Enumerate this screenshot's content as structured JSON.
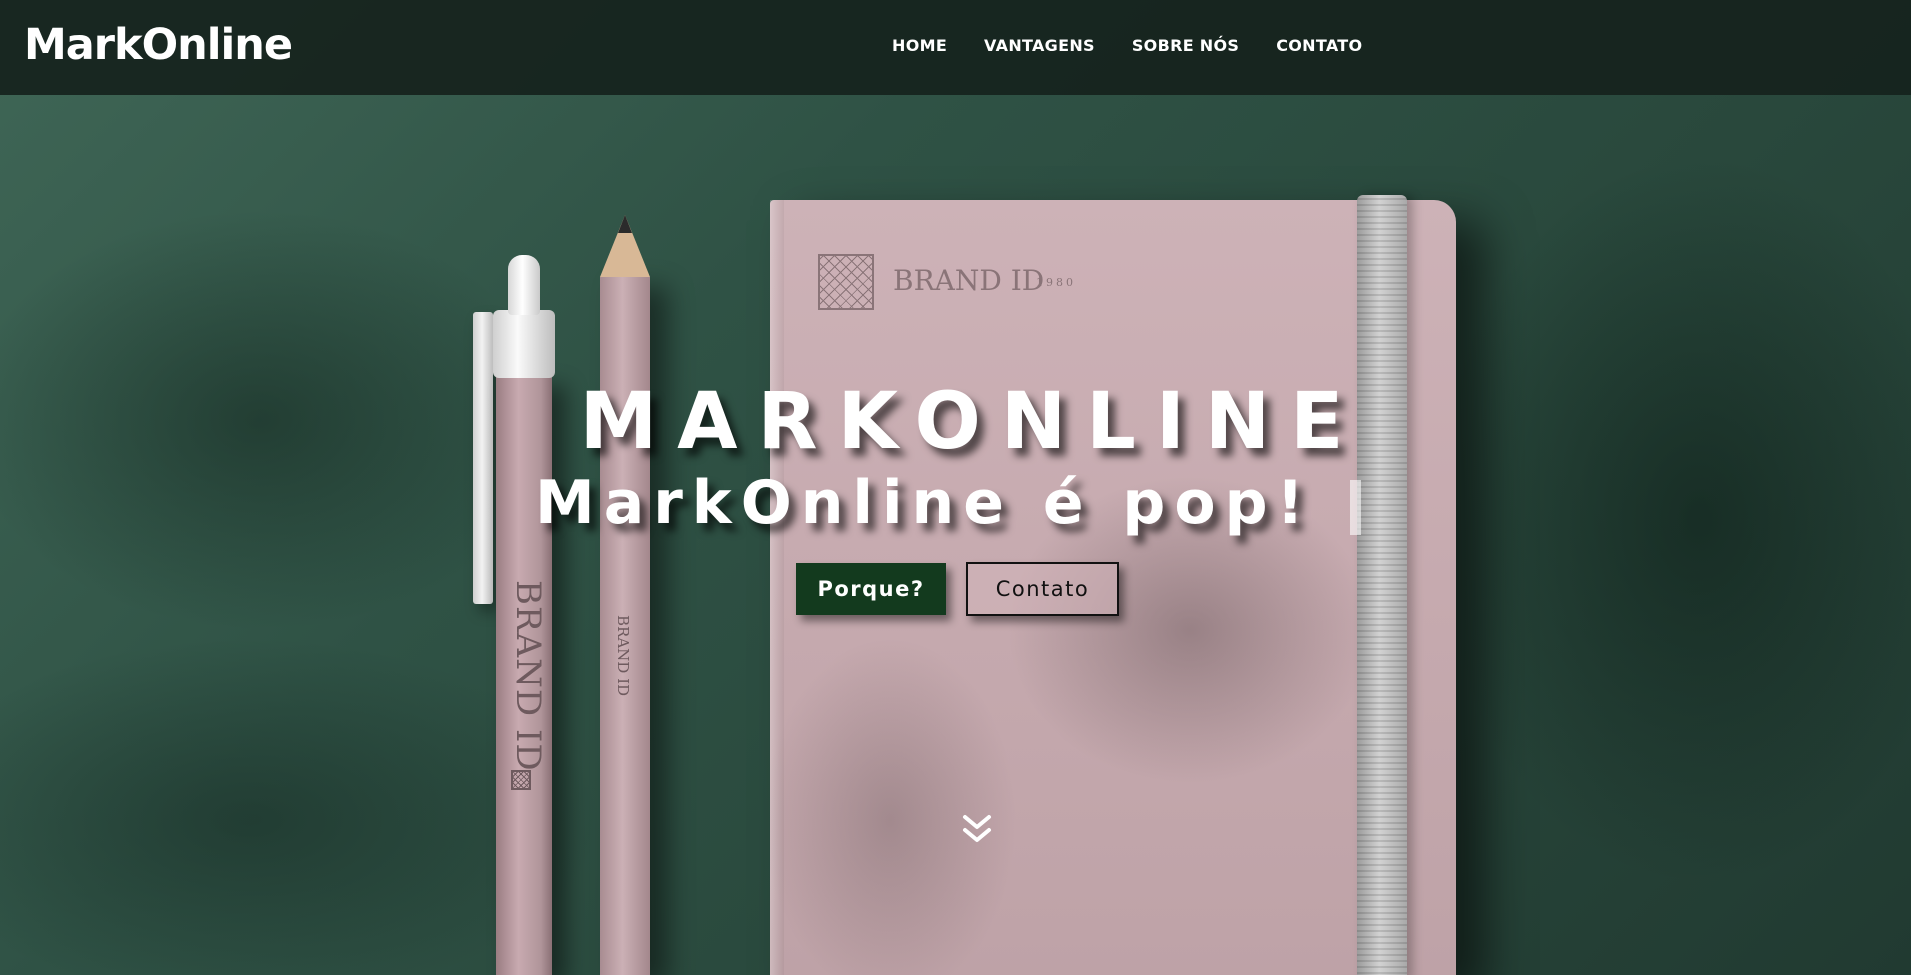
{
  "navbar": {
    "brand": "MarkOnline",
    "links": [
      {
        "label": "HOME"
      },
      {
        "label": "VANTAGENS"
      },
      {
        "label": "SOBRE NÓS"
      },
      {
        "label": "CONTATO"
      }
    ]
  },
  "hero": {
    "title": "MARKONLINE",
    "subtitle": "MarkOnline é pop!",
    "buttons": {
      "primary": "Porque?",
      "secondary": "Contato"
    },
    "scroll_icon": "double-chevron-down-icon"
  },
  "mockup": {
    "notebook_brand": "BRAND ID",
    "notebook_year": "1980",
    "pen_brand": "BRAND ID",
    "pencil_brand": "BRAND ID"
  },
  "colors": {
    "navbar_bg": "#16221d",
    "primary_button": "#133a1e",
    "hero_green": "#2f5245",
    "notebook_pink": "#c6aaaf",
    "text": "#ffffff"
  }
}
